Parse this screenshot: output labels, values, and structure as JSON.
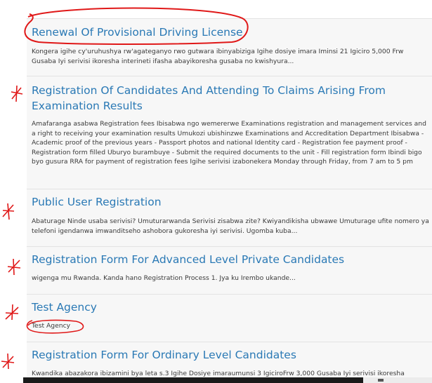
{
  "items": [
    {
      "title": "Renewal Of Provisional Driving License",
      "desc": "Kongera igihe cy'uruhushya rw'agateganyo rwo gutwara ibinyabiziga Igihe dosiye imara Iminsi 21 Igiciro 5,000 Frw Gusaba Iyi serivisi ikoresha interineti ifasha abayikoresha gusaba no kwishyura..."
    },
    {
      "title": "Registration Of Candidates And Attending To Claims Arising From Examination Results",
      "desc": "Amafaranga asabwa Registration fees Ibisabwa ngo wemererwe Examinations registration and management services and a right to receiving your examination results Umukozi ubishinzwe Examinations and Accreditation Department Ibisabwa - Academic proof of the previous years - Passport photos and national Identity card - Registration fee payment proof - Registration form filled Uburyo burambuye - Submit the required documents to the unit - Fill registration form Ibindi bigo byo gusura RRA for payment of registration fees Igihe serivisi izabonekera Monday through Friday, from 7 am to 5 pm"
    },
    {
      "title": "Public User Registration",
      "desc": "Abaturage Ninde usaba serivisi? Umuturarwanda Serivisi zisabwa zite? Kwiyandikisha ubwawe Umuturage ufite nomero ya telefoni igendanwa imwanditseho ashobora gukoresha iyi serivisi. Ugomba kuba..."
    },
    {
      "title": "Registration Form For Advanced Level Private Candidates",
      "desc": "wigenga mu Rwanda. Kanda hano Registration Process 1. Jya ku Irembo ukande..."
    },
    {
      "title": "Test Agency",
      "desc": "Test Agency"
    },
    {
      "title": "Registration Form For Ordinary Level Candidates",
      "desc": "Kwandika abazakora ibizamini bya leta s.3 Igihe Dosiye imaraumunsi 3 IgiciroFrw 3,000 Gusaba Iyi serivisi ikoresha"
    }
  ]
}
